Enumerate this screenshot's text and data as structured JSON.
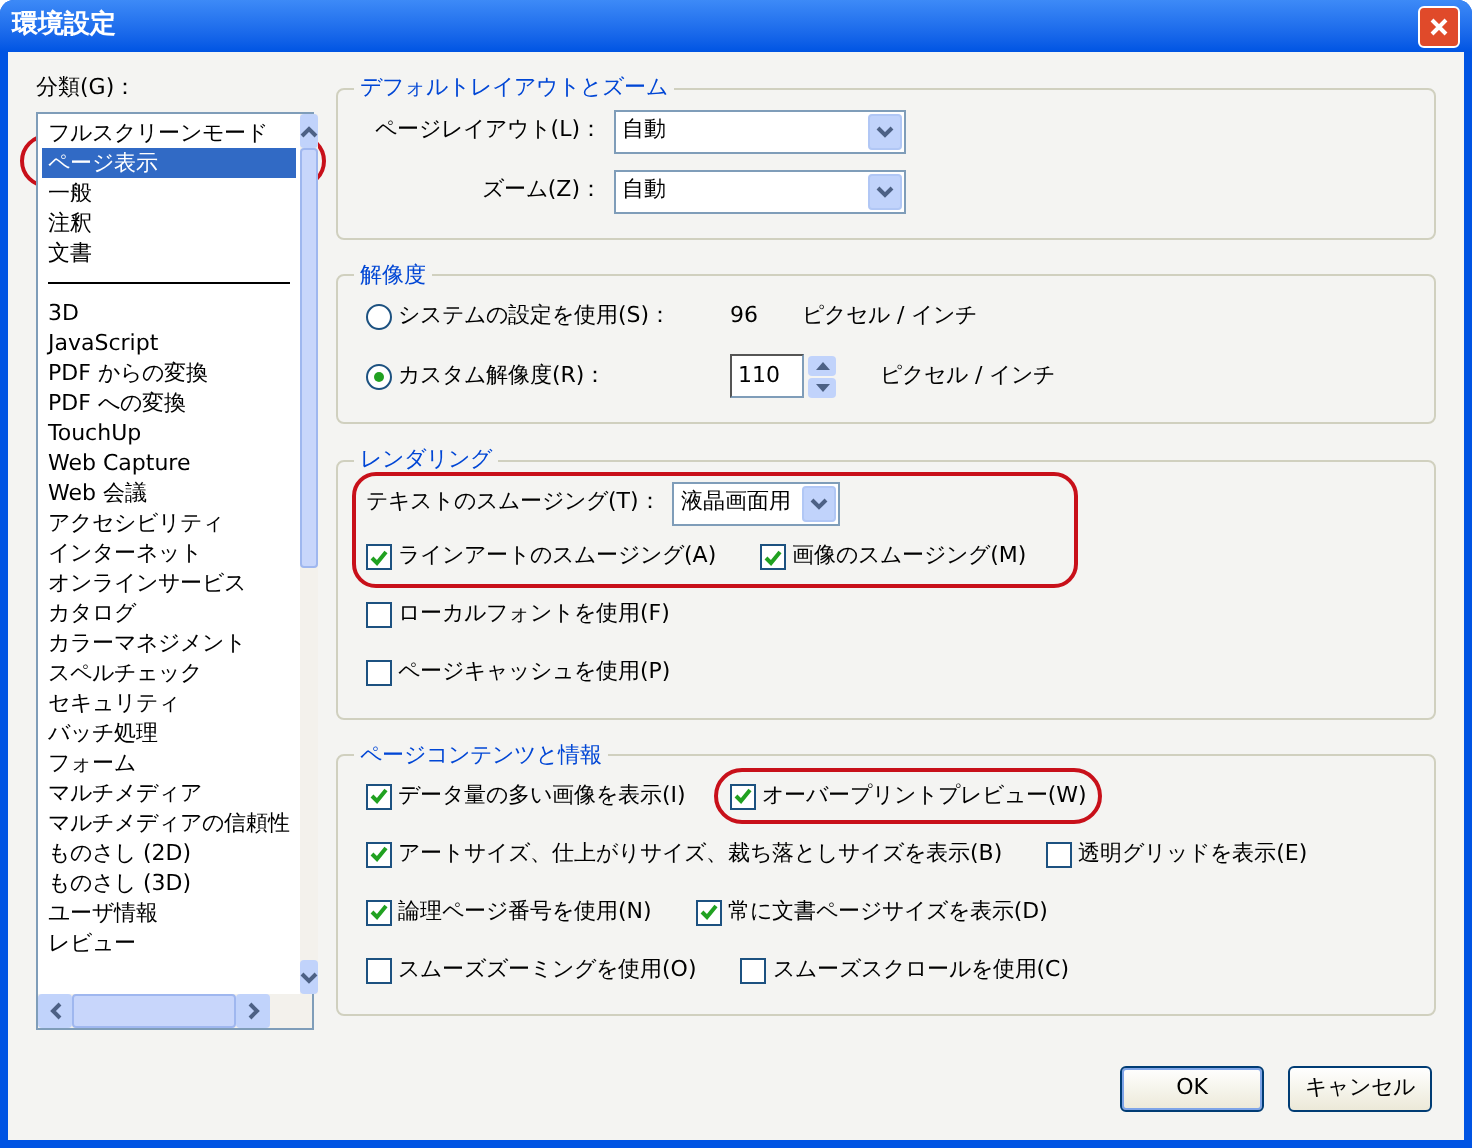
{
  "window": {
    "title": "環境設定"
  },
  "category": {
    "label": "分類(G)：",
    "items": [
      {
        "kind": "item",
        "label": "フルスクリーンモード",
        "selected": false,
        "circled": false
      },
      {
        "kind": "item",
        "label": "ページ表示",
        "selected": true,
        "circled": true
      },
      {
        "kind": "item",
        "label": "一般",
        "selected": false,
        "circled": false
      },
      {
        "kind": "item",
        "label": "注釈",
        "selected": false,
        "circled": false
      },
      {
        "kind": "item",
        "label": "文書",
        "selected": false,
        "circled": false
      },
      {
        "kind": "separator"
      },
      {
        "kind": "item",
        "label": "3D",
        "selected": false,
        "circled": false
      },
      {
        "kind": "item",
        "label": "JavaScript",
        "selected": false,
        "circled": false
      },
      {
        "kind": "item",
        "label": "PDF からの変換",
        "selected": false,
        "circled": false
      },
      {
        "kind": "item",
        "label": "PDF への変換",
        "selected": false,
        "circled": false
      },
      {
        "kind": "item",
        "label": "TouchUp",
        "selected": false,
        "circled": false
      },
      {
        "kind": "item",
        "label": "Web Capture",
        "selected": false,
        "circled": false
      },
      {
        "kind": "item",
        "label": "Web 会議",
        "selected": false,
        "circled": false
      },
      {
        "kind": "item",
        "label": "アクセシビリティ",
        "selected": false,
        "circled": false
      },
      {
        "kind": "item",
        "label": "インターネット",
        "selected": false,
        "circled": false
      },
      {
        "kind": "item",
        "label": "オンラインサービス",
        "selected": false,
        "circled": false
      },
      {
        "kind": "item",
        "label": "カタログ",
        "selected": false,
        "circled": false
      },
      {
        "kind": "item",
        "label": "カラーマネジメント",
        "selected": false,
        "circled": false
      },
      {
        "kind": "item",
        "label": "スペルチェック",
        "selected": false,
        "circled": false
      },
      {
        "kind": "item",
        "label": "セキュリティ",
        "selected": false,
        "circled": false
      },
      {
        "kind": "item",
        "label": "バッチ処理",
        "selected": false,
        "circled": false
      },
      {
        "kind": "item",
        "label": "フォーム",
        "selected": false,
        "circled": false
      },
      {
        "kind": "item",
        "label": "マルチメディア",
        "selected": false,
        "circled": false
      },
      {
        "kind": "item",
        "label": "マルチメディアの信頼性",
        "selected": false,
        "circled": false
      },
      {
        "kind": "item",
        "label": "ものさし (2D)",
        "selected": false,
        "circled": false
      },
      {
        "kind": "item",
        "label": "ものさし (3D)",
        "selected": false,
        "circled": false
      },
      {
        "kind": "item",
        "label": "ユーザ情報",
        "selected": false,
        "circled": false
      },
      {
        "kind": "item",
        "label": "レビュー",
        "selected": false,
        "circled": false
      }
    ]
  },
  "sections": [
    {
      "title": "デフォルトレイアウトとズーム",
      "kind": "form",
      "rows": [
        {
          "circled": false,
          "items": [
            {
              "kind": "dropdown",
              "label": "ページレイアウト(L)：",
              "value": "自動"
            }
          ]
        },
        {
          "circled": false,
          "items": [
            {
              "kind": "dropdown",
              "label": "ズーム(Z)：",
              "value": "自動"
            }
          ]
        }
      ]
    },
    {
      "title": "解像度",
      "kind": "options",
      "rows": [
        {
          "circled": false,
          "items": [
            {
              "kind": "radio",
              "label": "システムの設定を使用(S)：",
              "selected": false
            },
            {
              "kind": "text",
              "text": "96"
            },
            {
              "kind": "text",
              "text": "ピクセル / インチ"
            }
          ]
        },
        {
          "circled": false,
          "items": [
            {
              "kind": "radio",
              "label": "カスタム解像度(R)：",
              "selected": true
            },
            {
              "kind": "spinner",
              "value": "110"
            },
            {
              "kind": "text",
              "text": "ピクセル / インチ"
            }
          ]
        }
      ]
    },
    {
      "title": "レンダリング",
      "kind": "options",
      "rows": [
        {
          "circled": true,
          "items": [
            {
              "kind": "dropdown",
              "label": "テキストのスムージング(T)：",
              "value": "液晶画面用"
            }
          ]
        },
        {
          "circled": true,
          "items": [
            {
              "kind": "checkbox",
              "label": "ラインアートのスムージング(A)",
              "checked": true,
              "circled": false
            },
            {
              "kind": "checkbox",
              "label": "画像のスムージング(M)",
              "checked": true,
              "circled": false
            }
          ]
        },
        {
          "circled": false,
          "items": [
            {
              "kind": "checkbox",
              "label": "ローカルフォントを使用(F)",
              "checked": false,
              "circled": false
            }
          ]
        },
        {
          "circled": false,
          "items": [
            {
              "kind": "checkbox",
              "label": "ページキャッシュを使用(P)",
              "checked": false,
              "circled": false
            }
          ]
        }
      ]
    },
    {
      "title": "ページコンテンツと情報",
      "kind": "options",
      "rows": [
        {
          "circled": false,
          "items": [
            {
              "kind": "checkbox",
              "label": "データ量の多い画像を表示(I)",
              "checked": true,
              "circled": false
            },
            {
              "kind": "checkbox",
              "label": "オーバープリントプレビュー(W)",
              "checked": true,
              "circled": true
            }
          ]
        },
        {
          "circled": false,
          "items": [
            {
              "kind": "checkbox",
              "label": "アートサイズ、仕上がりサイズ、裁ち落としサイズを表示(B)",
              "checked": true,
              "circled": false
            },
            {
              "kind": "checkbox",
              "label": "透明グリッドを表示(E)",
              "checked": false,
              "circled": false
            }
          ]
        },
        {
          "circled": false,
          "items": [
            {
              "kind": "checkbox",
              "label": "論理ページ番号を使用(N)",
              "checked": true,
              "circled": false
            },
            {
              "kind": "checkbox",
              "label": "常に文書ページサイズを表示(D)",
              "checked": true,
              "circled": false
            }
          ]
        },
        {
          "circled": false,
          "items": [
            {
              "kind": "checkbox",
              "label": "スムーズズーミングを使用(O)",
              "checked": false,
              "circled": false
            },
            {
              "kind": "checkbox",
              "label": "スムーズスクロールを使用(C)",
              "checked": false,
              "circled": false
            }
          ]
        }
      ]
    }
  ],
  "buttons": [
    {
      "label": "OK",
      "default": true
    },
    {
      "label": "キャンセル",
      "default": false
    }
  ]
}
